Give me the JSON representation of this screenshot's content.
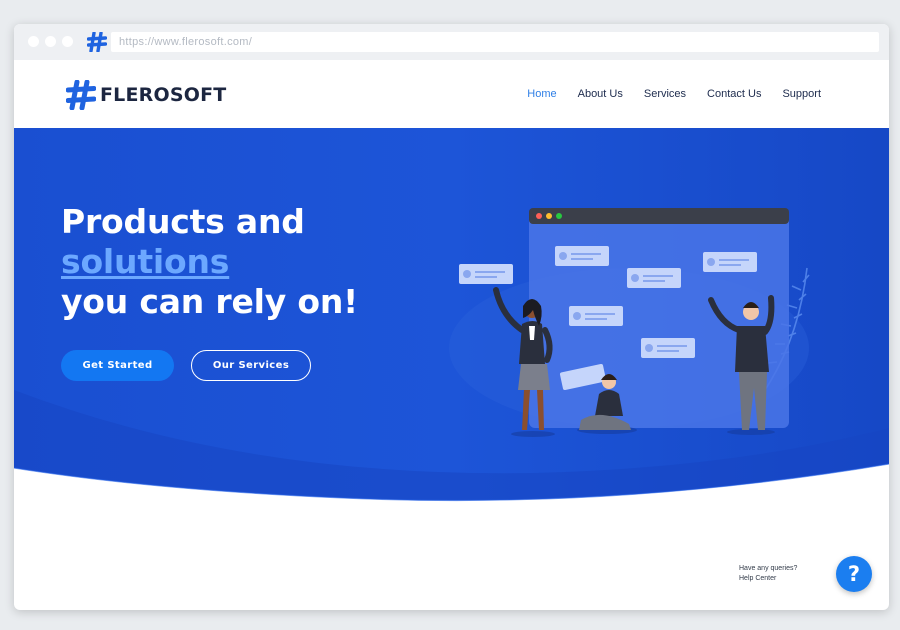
{
  "browser": {
    "url": "https://www.flerosoft.com/"
  },
  "brand": {
    "name": "FLEROSOFT",
    "accent": "#1f63e0"
  },
  "nav": {
    "items": [
      {
        "label": "Home",
        "active": true
      },
      {
        "label": "About Us",
        "active": false
      },
      {
        "label": "Services",
        "active": false
      },
      {
        "label": "Contact Us",
        "active": false
      },
      {
        "label": "Support",
        "active": false
      }
    ]
  },
  "hero": {
    "line1": "Products and",
    "line2": "solutions",
    "line3": "you can rely on!",
    "primary_button": "Get Started",
    "secondary_button": "Our Services",
    "background_color": "#1a4fd1",
    "highlight_color": "#6ca8ff"
  },
  "help": {
    "line1": "Have any queries?",
    "line2": "Help Center",
    "icon": "question-mark-icon",
    "glyph": "?"
  }
}
